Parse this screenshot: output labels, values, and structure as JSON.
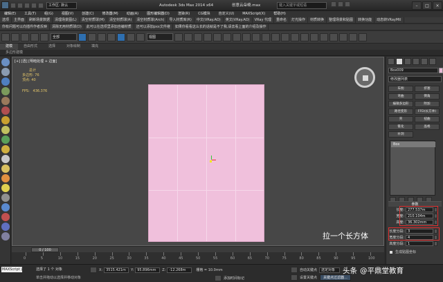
{
  "titlebar": {
    "workspace_label": "工作区: 默认",
    "app_title": "Autodesk 3ds Max  2014 x64",
    "file_name": "创意云朵椅.max",
    "search_placeholder": "键入关键字或短语"
  },
  "menubar": [
    "编辑(E)",
    "工具(T)",
    "组(G)",
    "视图(V)",
    "创建(C)",
    "修改器(M)",
    "动画(A)",
    "图形编辑器(D)",
    "渲染(R)",
    "CG模块",
    "自定义(U)",
    "MAXScript(X)",
    "帮助(H)"
  ],
  "plugin_bar1": [
    "选项",
    "主界面",
    "刷新场景数据",
    "清理场景图(L)",
    "清空材质球(M)",
    "清空材质球(A)",
    "清空材质球(Arch)",
    "导入材质库(R)",
    "中文(VRay.AO)",
    "英文(VRay.AO)",
    "VRay 代理",
    "重命名",
    "灯光操作",
    "材质转换",
    "整理场景和贴图",
    "转换功能",
    "动态转VRayMtl"
  ],
  "plugin_bar2": [
    "你有问题可以向插件作者反映",
    "清除无用材质球(D)",
    "此可以在选项里添加自编材质",
    "还可以添加pxx文件继",
    "如果你看看这么长的话就是不了我,请去看上面的介绍及操作"
  ],
  "maintoolbar": {
    "select_filter": "全部",
    "view_dropdown": "视图"
  },
  "ribbon": {
    "tabs": [
      "建模",
      "自由形式",
      "选择",
      "对象绘制",
      "填充"
    ],
    "active_tab": "建模",
    "sub": "多边形建模"
  },
  "viewport": {
    "label": "[+] [透] [明暗处理 + 边面]",
    "stats_title": "总计",
    "stats": [
      {
        "label": "多边形:",
        "value": "76"
      },
      {
        "label": "顶点:",
        "value": "40"
      }
    ],
    "fps_label": "FPS:",
    "fps_value": "436.376",
    "caption": "拉一个长方体",
    "object_color": "#f0c0dc"
  },
  "command_panel": {
    "object_name": "Box009",
    "modifier_list": "修改器列表",
    "buttons": [
      [
        "车削",
        "挤塞"
      ],
      [
        "弯曲",
        "倒角"
      ],
      [
        "编辑多边形",
        "附加"
      ],
      [
        "路径变形",
        "FFD(长方体)"
      ],
      [
        "壳",
        "扭曲"
      ],
      [
        "锥化",
        "晶格"
      ]
    ],
    "extra_button": "补洞",
    "stack_item": "Box",
    "params_header": "参数",
    "params": [
      {
        "label": "长度:",
        "value": "277.537m"
      },
      {
        "label": "宽度:",
        "value": "210.104m"
      },
      {
        "label": "高度:",
        "value": "36.302mm"
      },
      {
        "label": "长度分段:",
        "value": "3"
      },
      {
        "label": "宽度分段:",
        "value": "4"
      },
      {
        "label": "高度分段:",
        "value": "1"
      }
    ],
    "gen_map_coords": "生成贴图坐标"
  },
  "timeline": {
    "slider": "0 / 100",
    "ticks": [
      "0",
      "5",
      "10",
      "15",
      "20",
      "25",
      "30",
      "35",
      "40",
      "45",
      "50",
      "55",
      "60",
      "65",
      "70",
      "75",
      "80",
      "85",
      "90",
      "95",
      "100"
    ]
  },
  "status": {
    "maxscript": "MAXScript 迷",
    "selected": "选择了 1 个 对象",
    "hint": "单击并拖动以选择并移动对象",
    "x_label": "X:",
    "x": "3515.421m",
    "y_label": "Y:",
    "y": "95.896mm",
    "z_label": "Z:",
    "z": "-12.268m",
    "grid": "栅格 = 10.0mm",
    "add_tag": "添加时间标记",
    "autokey": "自动关键点",
    "selected_obj": "选定对象",
    "set_key": "设置关键点",
    "key_filter": "关键点过滤器..."
  },
  "watermark": {
    "brand": "头条",
    "author": "@平鼎堂教育"
  }
}
